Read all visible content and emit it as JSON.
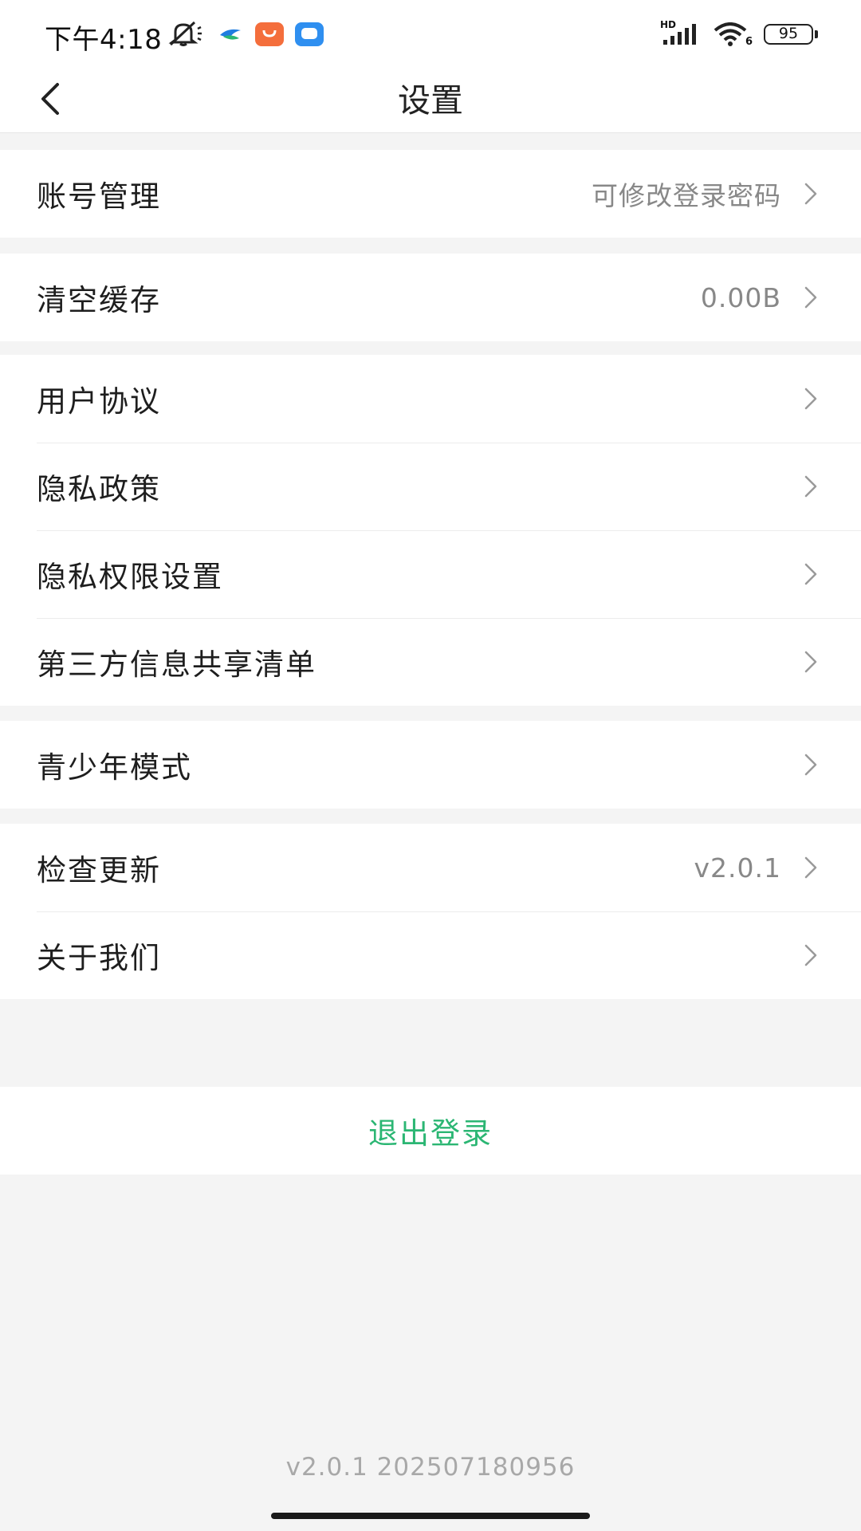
{
  "status_bar": {
    "time": "下午4:18",
    "battery": "95",
    "network_label": "HD",
    "wifi_label": "6",
    "icons": [
      "mute-icon",
      "bird-app-icon",
      "shopping-bag-app-icon",
      "message-app-icon",
      "signal-icon",
      "wifi-icon",
      "battery-icon"
    ]
  },
  "nav": {
    "title": "设置",
    "back_icon": "chevron-left-icon"
  },
  "groups": [
    {
      "items": [
        {
          "label": "账号管理",
          "value": "可修改登录密码"
        }
      ]
    },
    {
      "items": [
        {
          "label": "清空缓存",
          "value": "0.00B"
        }
      ]
    },
    {
      "items": [
        {
          "label": "用户协议",
          "value": ""
        },
        {
          "label": "隐私政策",
          "value": ""
        },
        {
          "label": "隐私权限设置",
          "value": ""
        },
        {
          "label": "第三方信息共享清单",
          "value": ""
        }
      ]
    },
    {
      "items": [
        {
          "label": "青少年模式",
          "value": ""
        }
      ]
    },
    {
      "items": [
        {
          "label": "检查更新",
          "value": "v2.0.1"
        },
        {
          "label": "关于我们",
          "value": ""
        }
      ]
    }
  ],
  "logout": {
    "label": "退出登录",
    "color": "#2bb673"
  },
  "footer": {
    "version": "v2.0.1 202507180956"
  }
}
